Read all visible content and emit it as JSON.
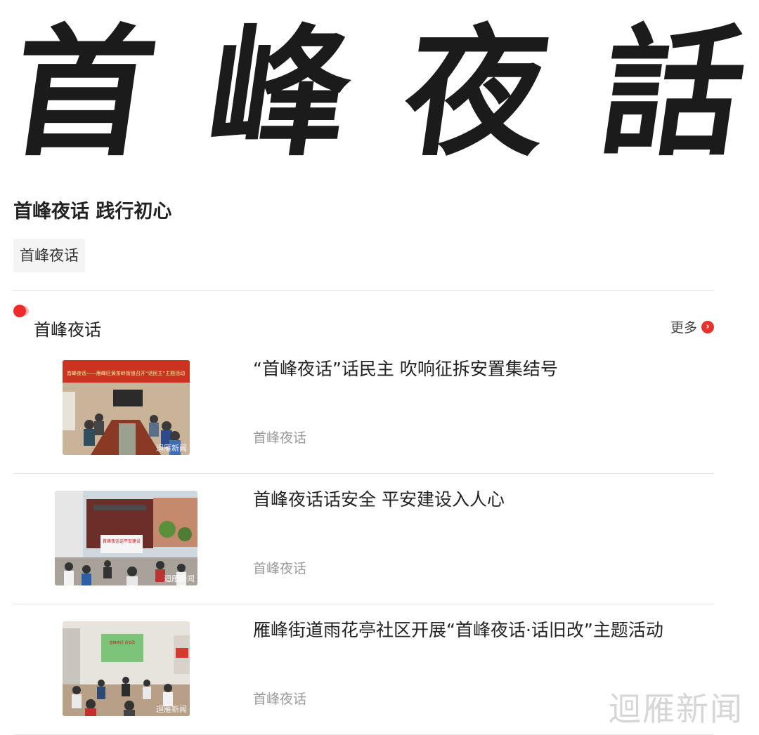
{
  "banner": {
    "calligraphy_chars": [
      "首",
      "峰",
      "夜",
      "話"
    ]
  },
  "page_title": "首峰夜话 践行初心",
  "tag_label": "首峰夜话",
  "section": {
    "title": "首峰夜话",
    "more_label": "更多",
    "accent_color": "#ee2a2a"
  },
  "news": [
    {
      "title": "“首峰夜话”话民主 吹响征拆安置集结号",
      "source": "首峰夜话",
      "thumb_banner": "首峰夜话——雁峰区黄茶岭街道召开“话民主”主题活动",
      "thumb_watermark": "迴雁新闻"
    },
    {
      "title": "首峰夜话话安全 平安建设入人心",
      "source": "首峰夜话",
      "thumb_banner": "首峰夜话话平安建设",
      "thumb_watermark": "迴雁新闻"
    },
    {
      "title": "雁峰街道雨花亭社区开展“首峰夜话·话旧改”主题活动",
      "source": "首峰夜话",
      "thumb_banner": "首峰夜话 话旧改",
      "thumb_watermark": "迴雁新闻"
    }
  ],
  "watermark": "迴雁新闻"
}
